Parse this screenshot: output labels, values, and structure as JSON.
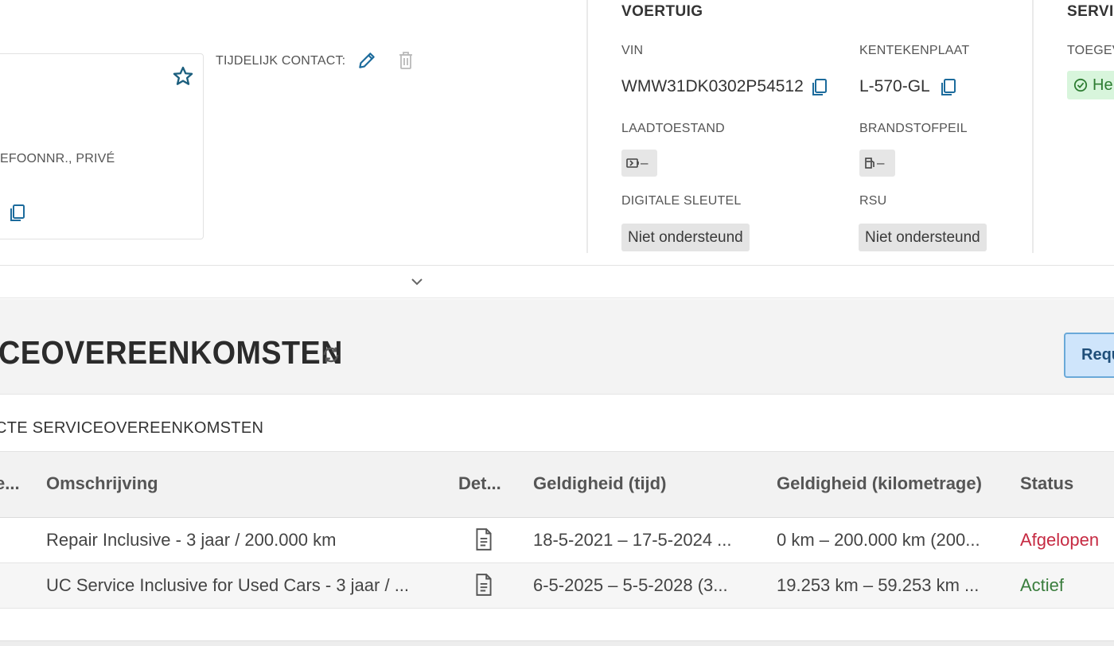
{
  "contact": {
    "phone_label": "efoonnr., privé",
    "temp_contact_label": "TIJDELIJK CONTACT:"
  },
  "vehicle": {
    "title": "VOERTUIG",
    "vin_label": "VIN",
    "vin_value": "WMW31DK0302P54512",
    "plate_label": "KENTEKENPLAAT",
    "plate_value": "L-570-GL",
    "charge_label": "LAADTOESTAND",
    "charge_value": "–",
    "fuel_label": "BRANDSTOFPEIL",
    "fuel_value": "–",
    "digital_key_label": "DIGITALE SLEUTEL",
    "digital_key_value": "Niet ondersteund",
    "rsu_label": "RSU",
    "rsu_value": "Niet ondersteund"
  },
  "service": {
    "title": "SERVIC",
    "assigned_label": "TOEGEV",
    "status_value": "He"
  },
  "agreements": {
    "title": "CEOVEREENKOMSTEN",
    "request_button": "Requ",
    "subtitle": "CTE SERVICEOVEREENKOMSTEN",
    "columns": [
      "e...",
      "Omschrijving",
      "Det...",
      "Geldigheid (tijd)",
      "Geldigheid (kilometrage)",
      "Status"
    ],
    "rows": [
      {
        "first": "",
        "description": "Repair Inclusive - 3 jaar / 200.000 km",
        "validity_time": "18-5-2021 – 17-5-2024 ...",
        "validity_km": "0 km – 200.000 km (200...",
        "status": "Afgelopen"
      },
      {
        "first": "",
        "description": "UC Service Inclusive for Used Cars - 3 jaar / ...",
        "validity_time": "6-5-2025 – 5-5-2028 (3...",
        "validity_km": "19.253 km – 59.253 km ...",
        "status": "Actief"
      }
    ]
  },
  "colors": {
    "accent": "#1c6b9c",
    "status_expired": "#c62a42",
    "status_active": "#3a7d3d"
  }
}
